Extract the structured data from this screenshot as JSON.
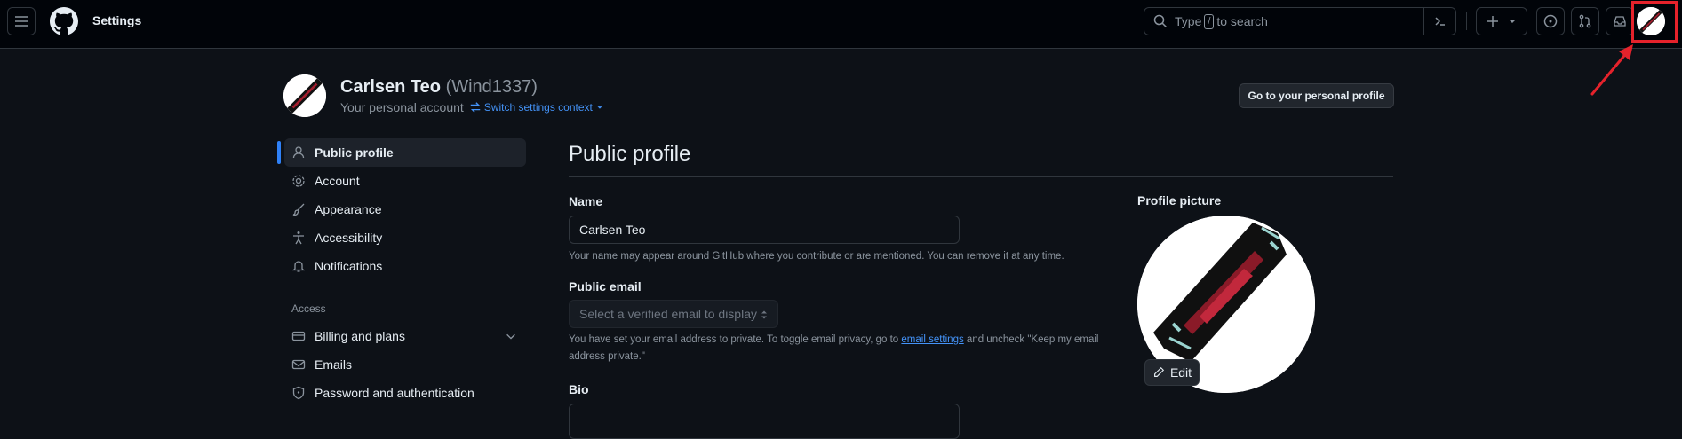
{
  "header": {
    "context_title": "Settings",
    "search": {
      "prefix": "Type",
      "key": "/",
      "suffix": "to search"
    }
  },
  "account": {
    "name": "Carlsen Teo",
    "login": "(Wind1337)",
    "subtitle": "Your personal account",
    "switch_context": "Switch settings context",
    "go_to_profile": "Go to your personal profile"
  },
  "sidebar": {
    "items": [
      {
        "label": "Public profile",
        "icon": "person-icon"
      },
      {
        "label": "Account",
        "icon": "gear-icon"
      },
      {
        "label": "Appearance",
        "icon": "paintbrush-icon"
      },
      {
        "label": "Accessibility",
        "icon": "accessibility-icon"
      },
      {
        "label": "Notifications",
        "icon": "bell-icon"
      }
    ],
    "access_heading": "Access",
    "access_items": [
      {
        "label": "Billing and plans",
        "icon": "credit-card-icon"
      },
      {
        "label": "Emails",
        "icon": "mail-icon"
      },
      {
        "label": "Password and authentication",
        "icon": "shield-lock-icon"
      }
    ]
  },
  "main": {
    "title": "Public profile",
    "name_label": "Name",
    "name_value": "Carlsen Teo",
    "name_note": "Your name may appear around GitHub where you contribute or are mentioned. You can remove it at any time.",
    "email_label": "Public email",
    "email_placeholder": "Select a verified email to display",
    "email_note_before": "You have set your email address to private. To toggle email privacy, go to",
    "email_note_link": "email settings",
    "email_note_after": "and uncheck \"Keep my email address private.\"",
    "bio_label": "Bio",
    "picture_label": "Profile picture",
    "edit_label": "Edit"
  },
  "colors": {
    "accent": "#2f81f7",
    "link": "#4493f8",
    "annotation": "#e5222b"
  }
}
